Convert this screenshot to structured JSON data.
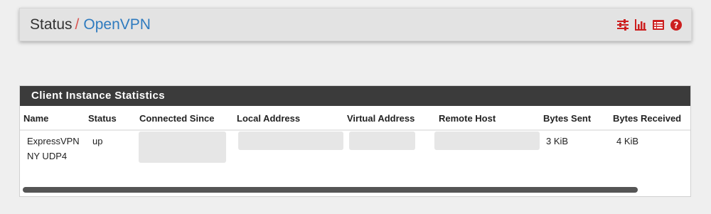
{
  "breadcrumb": {
    "root": "Status",
    "separator": "/",
    "current": "OpenVPN"
  },
  "toolbar_icons": [
    "settings-sliders-icon",
    "bar-chart-icon",
    "list-table-icon",
    "help-icon"
  ],
  "colors": {
    "accent_red": "#cc1f1f",
    "link_blue": "#2f7bbf",
    "panel_heading": "#3b3b3b"
  },
  "panel": {
    "title": "Client Instance Statistics",
    "columns": [
      "Name",
      "Status",
      "Connected Since",
      "Local Address",
      "Virtual Address",
      "Remote Host",
      "Bytes Sent",
      "Bytes Received"
    ],
    "rows": [
      {
        "name_line1": "ExpressVPN",
        "name_line2": "NY UDP4",
        "status": "up",
        "bytes_sent": "3 KiB",
        "bytes_received": "4 KiB"
      }
    ]
  }
}
